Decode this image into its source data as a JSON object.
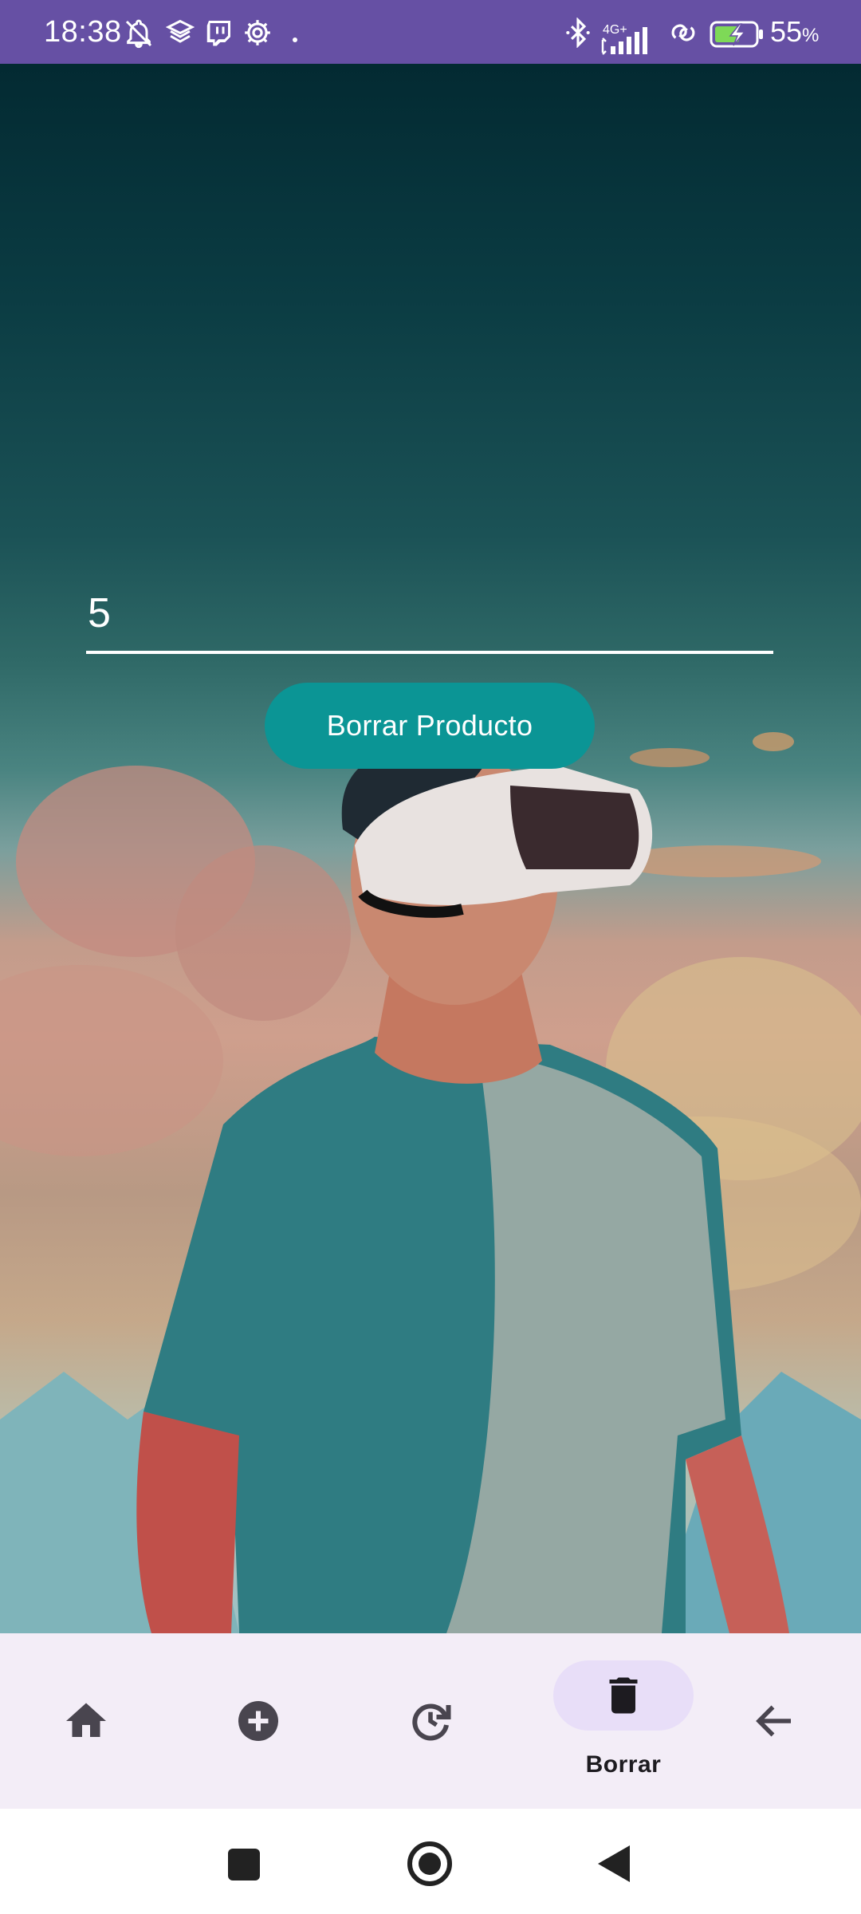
{
  "status_bar": {
    "time": "18:38",
    "network": "4G+",
    "battery_percent": "55",
    "battery_unit": "%",
    "left_icons": [
      "bell-off-icon",
      "layers-icon",
      "twitch-icon",
      "settings-icon",
      "dot-icon"
    ],
    "right_icons": [
      "bluetooth-icon",
      "signal-icon",
      "data-saver-icon",
      "battery-charging-icon"
    ]
  },
  "form": {
    "product_id_value": "5",
    "delete_button_label": "Borrar Producto"
  },
  "bottom_nav": {
    "items": [
      {
        "icon": "home-icon",
        "label": ""
      },
      {
        "icon": "add-circle-icon",
        "label": ""
      },
      {
        "icon": "update-icon",
        "label": ""
      },
      {
        "icon": "trash-icon",
        "label": "Borrar",
        "active": true
      },
      {
        "icon": "arrow-back-icon",
        "label": ""
      }
    ],
    "active_label": "Borrar"
  },
  "system_nav": {
    "icons": [
      "recents-icon",
      "home-circle-icon",
      "back-triangle-icon"
    ]
  },
  "colors": {
    "status_bar": "#6650a4",
    "button": "#0b9595",
    "nav_background": "#f3edf7",
    "nav_active_pill": "#e8def8",
    "nav_icon": "#49454f"
  }
}
